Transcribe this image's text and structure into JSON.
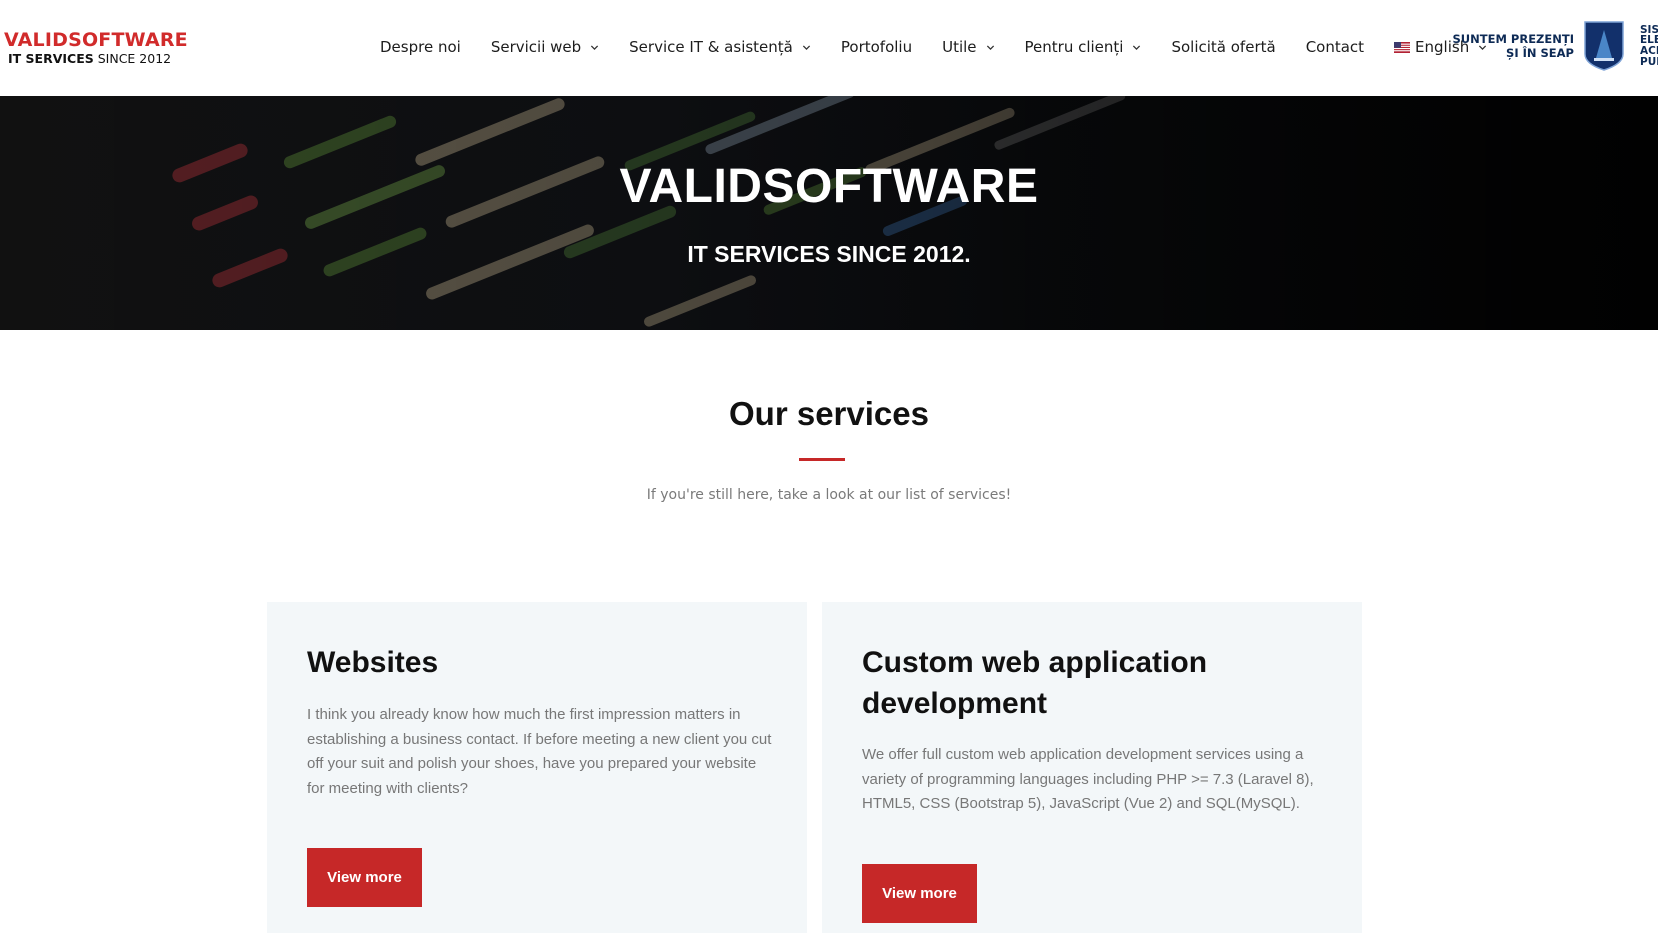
{
  "brand": {
    "name": "VALIDSOFTWARE",
    "tagline_bold": "IT SERVICES",
    "tagline_rest": " SINCE 2012"
  },
  "nav": {
    "items": [
      {
        "label": "Despre noi",
        "has_dropdown": false
      },
      {
        "label": "Servicii web",
        "has_dropdown": true
      },
      {
        "label": "Service IT & asistență",
        "has_dropdown": true
      },
      {
        "label": "Portofoliu",
        "has_dropdown": false
      },
      {
        "label": "Utile",
        "has_dropdown": true
      },
      {
        "label": "Pentru clienți",
        "has_dropdown": true
      },
      {
        "label": "Solicită ofertă",
        "has_dropdown": false
      },
      {
        "label": "Contact",
        "has_dropdown": false
      }
    ],
    "language": {
      "label": "English",
      "flag": "us-flag-icon"
    }
  },
  "seap": {
    "line1": "SUNTEM PREZENȚI",
    "line2": "ȘI ÎN SEAP",
    "side_lines": [
      "SIST",
      "ELEC",
      "ACHI",
      "PUBL"
    ]
  },
  "hero": {
    "title": "VALIDSOFTWARE",
    "subtitle": "IT SERVICES SINCE 2012."
  },
  "services": {
    "title": "Our services",
    "description": "If you're still here, take a look at our list of services!",
    "cards": [
      {
        "title": "Websites",
        "text": "I think you already know how much the first impression matters in establishing a business contact. If before meeting a new client you cut off your suit and polish your shoes, have you prepared your website for meeting with clients?",
        "button": "View more"
      },
      {
        "title": "Custom web application development",
        "text": "We offer full custom web application development services using a variety of programming languages including PHP >= 7.3 (Laravel 8), HTML5, CSS (Bootstrap 5), JavaScript (Vue 2) and SQL(MySQL).",
        "button": "View more"
      }
    ]
  },
  "colors": {
    "accent": "#c62828",
    "brand_red": "#d12b2b",
    "seap_blue": "#0d2a55",
    "card_bg": "#f3f7f9"
  }
}
